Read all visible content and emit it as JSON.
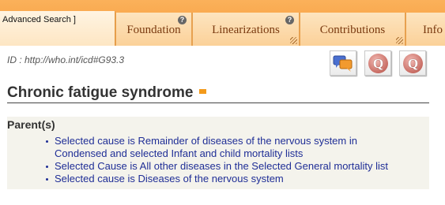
{
  "header": {
    "advanced_search_label": "Advanced Search ]",
    "tabs": [
      {
        "label": "Foundation",
        "help": "?"
      },
      {
        "label": "Linearizations",
        "help": "?"
      },
      {
        "label": "Contributions"
      },
      {
        "label": "Info"
      }
    ]
  },
  "entity": {
    "id_text": "ID : http://who.int/icd#G93.3",
    "title": "Chronic fatigue syndrome"
  },
  "actions": {
    "comments_icon": "speech-bubbles-icon",
    "q_badge_1": "Q",
    "q_badge_2": "Q"
  },
  "parents": {
    "heading": "Parent(s)",
    "items": [
      {
        "line1": "Selected cause is Remainder of diseases of the nervous system in",
        "line2": "Condensed and selected Infant and child mortality lists"
      },
      {
        "line1": "Selected Cause is All other diseases in the Selected General mortality list",
        "line2": ""
      },
      {
        "line1": "Selected cause is Diseases of the nervous system",
        "line2": ""
      }
    ]
  },
  "colors": {
    "accent_orange": "#f6993a",
    "link_blue": "#1f2e96",
    "tab_text": "#7a3a10"
  }
}
